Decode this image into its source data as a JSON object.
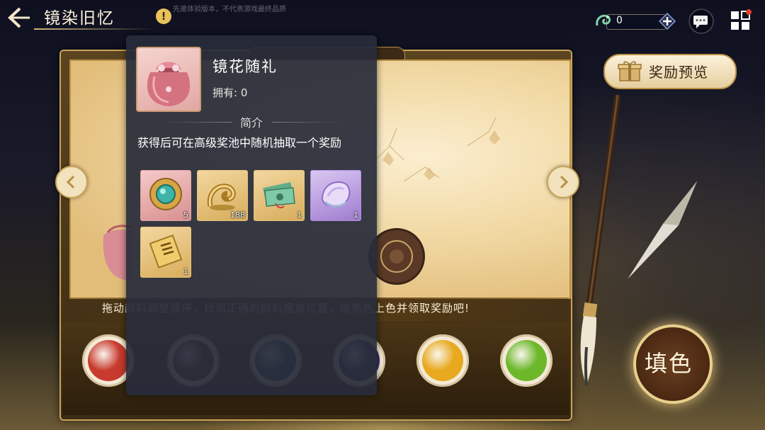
{
  "header": {
    "title": "镜染旧忆",
    "info_icon": "!",
    "disclaimer": "先遣体验版本，不代表游戏最终品质"
  },
  "currency": {
    "icon": "jade-dragon-icon",
    "value": "0"
  },
  "main": {
    "instruction": "拖动颜料调整顺序，找到正确的颜料摆放位置，给角色上色并领取奖励吧!",
    "swatches": [
      {
        "color": "#c83a2e"
      },
      {
        "color": "#5a2a1e"
      },
      {
        "color": "#1e5066"
      },
      {
        "color": "#3a2e6a"
      },
      {
        "color": "#e8a91e"
      },
      {
        "color": "#6cb82a"
      }
    ]
  },
  "reward_preview": {
    "label": "奖励预览"
  },
  "fill_button": {
    "label": "填色"
  },
  "popup": {
    "item_name": "镜花随礼",
    "owned": "拥有: 0",
    "section_title": "简介",
    "description": "获得后可在高级奖池中随机抽取一个奖励",
    "rewards": [
      {
        "name": "jade-ornament",
        "count": "5",
        "rarity": "pink"
      },
      {
        "name": "gold-dragon",
        "count": "188",
        "rarity": "gold"
      },
      {
        "name": "banknotes",
        "count": "1",
        "rarity": "gold"
      },
      {
        "name": "crystal-shell",
        "count": "1",
        "rarity": "purple"
      },
      {
        "name": "golden-scroll",
        "count": "1",
        "rarity": "gold"
      }
    ]
  }
}
